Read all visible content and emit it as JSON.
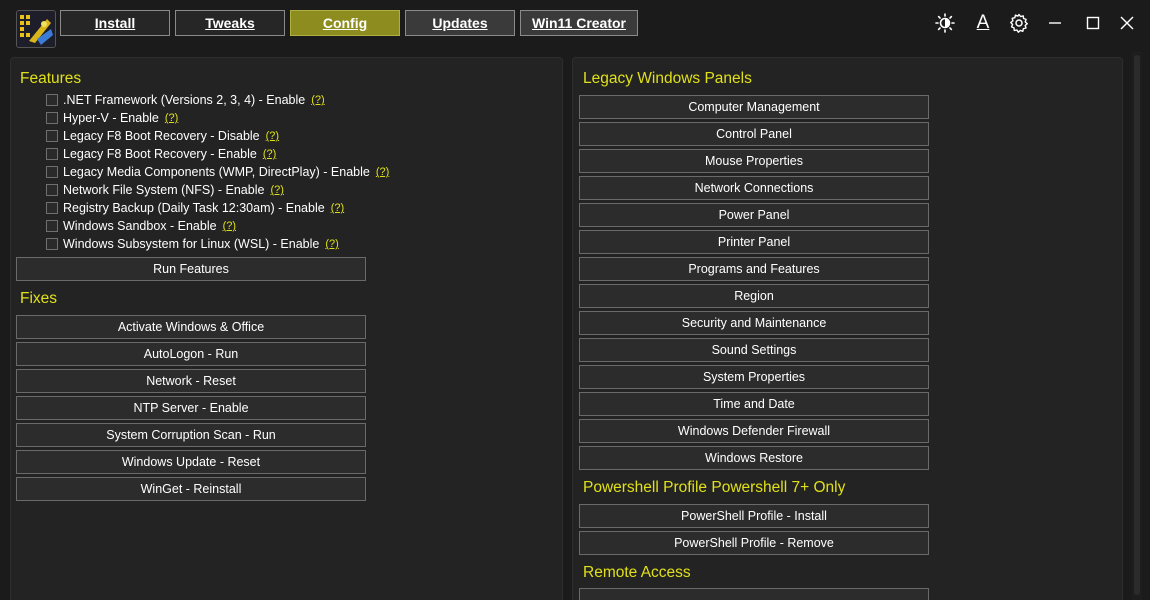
{
  "nav": {
    "tabs": [
      {
        "label": "Install"
      },
      {
        "label": "Tweaks"
      },
      {
        "label": "Config"
      },
      {
        "label": "Updates"
      },
      {
        "label": "Win11 Creator"
      }
    ],
    "active_tab": "Config"
  },
  "window_controls": {
    "icons": [
      "theme-icon",
      "font-icon",
      "settings-icon",
      "minimize-icon",
      "maximize-icon",
      "close-icon"
    ],
    "font_glyph": "A"
  },
  "features": {
    "title": "Features",
    "help_label": "(?)",
    "items": [
      {
        "label": ".NET Framework (Versions 2, 3, 4) - Enable"
      },
      {
        "label": "Hyper-V - Enable"
      },
      {
        "label": "Legacy F8 Boot Recovery - Disable"
      },
      {
        "label": "Legacy F8 Boot Recovery - Enable"
      },
      {
        "label": "Legacy Media Components (WMP, DirectPlay) - Enable"
      },
      {
        "label": "Network File System (NFS) - Enable"
      },
      {
        "label": "Registry Backup (Daily Task 12:30am) - Enable"
      },
      {
        "label": "Windows Sandbox - Enable"
      },
      {
        "label": "Windows Subsystem for Linux (WSL) - Enable"
      }
    ],
    "run_button": "Run Features"
  },
  "fixes": {
    "title": "Fixes",
    "buttons": [
      "Activate Windows & Office",
      "AutoLogon - Run",
      "Network - Reset",
      "NTP Server - Enable",
      "System Corruption Scan - Run",
      "Windows Update - Reset",
      "WinGet - Reinstall"
    ]
  },
  "legacy_panels": {
    "title": "Legacy Windows Panels",
    "buttons": [
      "Computer Management",
      "Control Panel",
      "Mouse Properties",
      "Network Connections",
      "Power Panel",
      "Printer Panel",
      "Programs and Features",
      "Region",
      "Security and Maintenance",
      "Sound Settings",
      "System Properties",
      "Time and Date",
      "Windows Defender Firewall",
      "Windows Restore"
    ]
  },
  "powershell_profile": {
    "title": "Powershell Profile Powershell 7+ Only",
    "buttons": [
      "PowerShell Profile - Install",
      "PowerShell Profile - Remove"
    ]
  },
  "remote_access": {
    "title": "Remote Access"
  },
  "colors": {
    "accent_yellow": "#e0e01a",
    "active_tab": "#8c8c1f",
    "background": "#1b1b1b",
    "panel": "#232323"
  }
}
